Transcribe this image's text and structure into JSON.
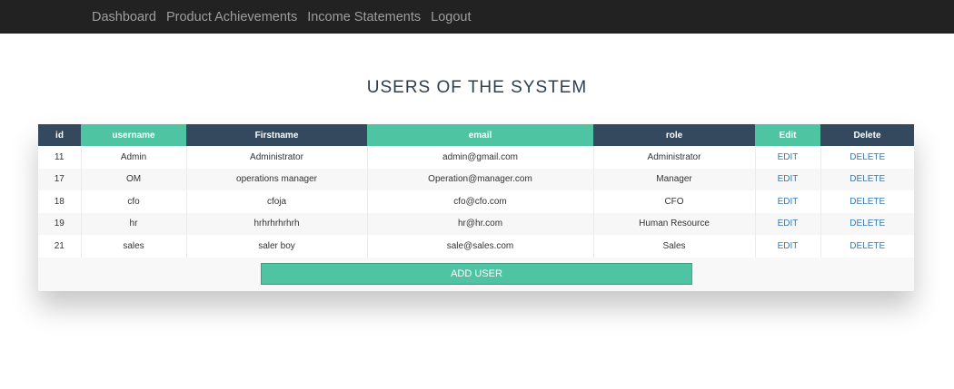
{
  "nav": {
    "links": [
      "Dashboard",
      "Product Achievements",
      "Income Statements",
      "Logout"
    ]
  },
  "page": {
    "title": "USERS OF THE SYSTEM"
  },
  "table": {
    "headers": [
      "id",
      "username",
      "Firstname",
      "email",
      "role",
      "Edit",
      "Delete"
    ],
    "rows": [
      {
        "id": "11",
        "username": "Admin",
        "firstname": "Administrator",
        "email": "admin@gmail.com",
        "role": "Administrator",
        "edit": "EDIT",
        "delete": "DELETE"
      },
      {
        "id": "17",
        "username": "OM",
        "firstname": "operations manager",
        "email": "Operation@manager.com",
        "role": "Manager",
        "edit": "EDIT",
        "delete": "DELETE"
      },
      {
        "id": "18",
        "username": "cfo",
        "firstname": "cfoja",
        "email": "cfo@cfo.com",
        "role": "CFO",
        "edit": "EDIT",
        "delete": "DELETE"
      },
      {
        "id": "19",
        "username": "hr",
        "firstname": "hrhrhrhrhrh",
        "email": "hr@hr.com",
        "role": "Human Resource",
        "edit": "EDIT",
        "delete": "DELETE"
      },
      {
        "id": "21",
        "username": "sales",
        "firstname": "saler boy",
        "email": "sale@sales.com",
        "role": "Sales",
        "edit": "EDIT",
        "delete": "DELETE"
      }
    ]
  },
  "actions": {
    "add_user_label": "ADD USER"
  },
  "colors": {
    "navbar": "#222222",
    "header_dark": "#34495e",
    "header_green": "#4fc4a2",
    "link": "#337ab7",
    "title": "#2c3e50"
  }
}
